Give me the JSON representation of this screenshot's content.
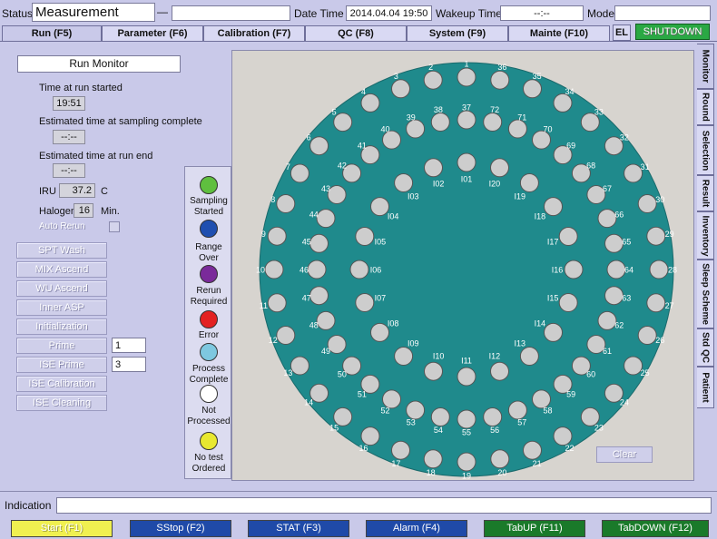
{
  "header": {
    "status_label": "Status",
    "status_value": "Measurement",
    "dash": "—",
    "date_time_label": "Date Time",
    "date_time_value": "2014.04.04 19:50",
    "wakeup_label": "Wakeup Time",
    "wakeup_value": "--:--",
    "mode_label": "Mode",
    "mode_value": ""
  },
  "tabs": [
    {
      "label": "Run (F5)"
    },
    {
      "label": "Parameter (F6)"
    },
    {
      "label": "Calibration (F7)"
    },
    {
      "label": "QC (F8)"
    },
    {
      "label": "System (F9)"
    },
    {
      "label": "Mainte (F10)"
    }
  ],
  "el_label": "EL",
  "shutdown_label": "SHUTDOWN",
  "side_tabs": [
    {
      "label": "Monitor"
    },
    {
      "label": "Round"
    },
    {
      "label": "Selection"
    },
    {
      "label": "Result"
    },
    {
      "label": "Inventory"
    },
    {
      "label": "Sleep Scheme"
    },
    {
      "label": "Std QC"
    },
    {
      "label": "Patient"
    }
  ],
  "run_monitor": {
    "title": "Run Monitor",
    "time_started_label": "Time at run started",
    "time_started_value": "19:51",
    "sampling_complete_label": "Estimated time at sampling complete",
    "sampling_complete_value": "--:--",
    "run_end_label": "Estimated time at run end",
    "run_end_value": "--:--",
    "iru_label": "IRU",
    "iru_value": "37.2",
    "iru_unit": "C",
    "halogen_label": "Halogen",
    "halogen_value": "16",
    "halogen_unit": "Min.",
    "auto_rerun_label": "Auto Rerun"
  },
  "actions": [
    {
      "label": "SPT Wash"
    },
    {
      "label": "MIX Ascend"
    },
    {
      "label": "WU Ascend"
    },
    {
      "label": "Inner ASP"
    },
    {
      "label": "Initialization"
    },
    {
      "label": "Prime",
      "value": "1"
    },
    {
      "label": "ISE Prime",
      "value": "3"
    },
    {
      "label": "ISE Calibration"
    },
    {
      "label": "ISE Cleaning"
    }
  ],
  "legend": [
    {
      "label": "Sampling Started",
      "color": "#5fbf3f"
    },
    {
      "label": "Range Over",
      "color": "#1f4fb0"
    },
    {
      "label": "Rerun Required",
      "color": "#7a2a9a"
    },
    {
      "label": "Error",
      "color": "#e32121"
    },
    {
      "label": "Process Complete",
      "color": "#7ec8e0"
    },
    {
      "label": "Not Processed",
      "color": "#ffffff"
    },
    {
      "label": "No test Ordered",
      "color": "#e8e830"
    }
  ],
  "tray": {
    "disk_color": "#1f8a8c",
    "slot_color": "#cdcdcd",
    "outer": [
      "1",
      "2",
      "3",
      "4",
      "5",
      "6",
      "7",
      "8",
      "9",
      "10",
      "11",
      "12",
      "13",
      "14",
      "15",
      "16",
      "17",
      "18",
      "19",
      "20",
      "21",
      "22",
      "23",
      "24",
      "25",
      "26",
      "27",
      "28",
      "29",
      "30",
      "31",
      "32",
      "33",
      "34",
      "35",
      "36"
    ],
    "middle": [
      "37",
      "38",
      "39",
      "40",
      "41",
      "42",
      "43",
      "44",
      "45",
      "46",
      "47",
      "48",
      "49",
      "50",
      "51",
      "52",
      "53",
      "54",
      "55",
      "56",
      "57",
      "58",
      "59",
      "60",
      "61",
      "62",
      "63",
      "64",
      "65",
      "66",
      "67",
      "68",
      "69",
      "70",
      "71",
      "72"
    ],
    "inner": [
      "I01",
      "I02",
      "I03",
      "I04",
      "I05",
      "I06",
      "I07",
      "I08",
      "I09",
      "I10",
      "I11",
      "I12",
      "I13",
      "I14",
      "I15",
      "I16",
      "I17",
      "I18",
      "I19",
      "I20"
    ]
  },
  "clear_label": "Clear",
  "indication_label": "Indication",
  "indication_value": "",
  "footer": [
    {
      "label": "Start (F1)",
      "color": "#f0f050"
    },
    {
      "label": "SStop (F2)",
      "color": "#1f4aa8"
    },
    {
      "label": "STAT (F3)",
      "color": "#1f4aa8"
    },
    {
      "label": "Alarm (F4)",
      "color": "#1f4aa8"
    },
    {
      "label": "TabUP (F11)",
      "color": "#1a7a2a"
    },
    {
      "label": "TabDOWN (F12)",
      "color": "#1a7a2a"
    }
  ]
}
